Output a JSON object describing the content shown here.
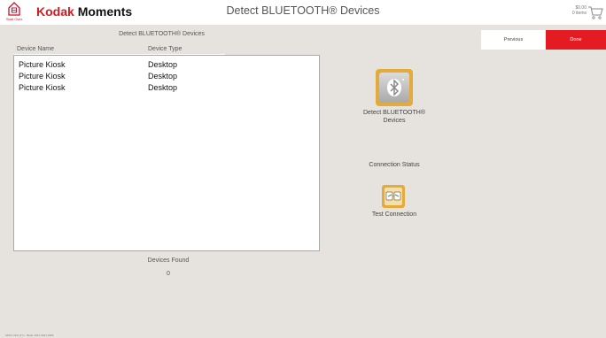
{
  "header": {
    "start_over_label": "Start Over",
    "brand_kodak": "Kodak",
    "brand_moments": "Moments",
    "title": "Detect BLUETOOTH® Devices",
    "cart_amount": "$0.00",
    "cart_items": "0 items"
  },
  "table": {
    "title": "Detect BLUETOOTH® Devices",
    "columns": [
      "Device Name",
      "Device Type"
    ],
    "rows": [
      [
        "Picture Kiosk",
        "Desktop"
      ],
      [
        "Picture Kiosk",
        "Desktop"
      ],
      [
        "Picture Kiosk",
        "Desktop"
      ]
    ]
  },
  "devices_found": {
    "label": "Devices Found",
    "count": "0"
  },
  "actions": {
    "previous": "Previous",
    "done": "Done",
    "detect_label": "Detect BLUETOOTH®",
    "detect_label_2": "Devices",
    "connection_status": "Connection Status",
    "test_connection": "Test Connection"
  },
  "footer": {
    "build": "KPKV V9.0 (TY) - Build: 2017.0327.2365"
  },
  "colors": {
    "brand_red": "#d71920",
    "done_red": "#e41b23",
    "tile_gold": "#e3ab3b",
    "background": "#e6e3de"
  },
  "icons": {
    "start_over": "home-icon",
    "cart": "cart-icon",
    "bluetooth": "bluetooth-icon",
    "test": "test-connection-icon"
  }
}
